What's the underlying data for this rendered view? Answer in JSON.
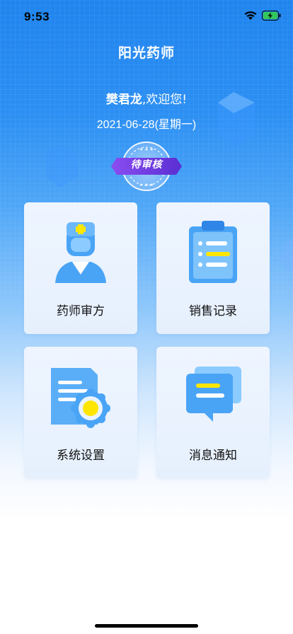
{
  "status_bar": {
    "time": "9:53"
  },
  "header": {
    "title": "阳光药师",
    "user_name": "樊君龙",
    "welcome_suffix": ",欢迎您!",
    "date": "2021-06-28(星期一)"
  },
  "badge": {
    "label": "待审核"
  },
  "menu": {
    "items": [
      {
        "label": "药师审方",
        "icon": "pharmacist-icon"
      },
      {
        "label": "销售记录",
        "icon": "clipboard-icon"
      },
      {
        "label": "系统设置",
        "icon": "settings-document-icon"
      },
      {
        "label": "消息通知",
        "icon": "message-icon"
      }
    ]
  },
  "colors": {
    "primary": "#1f84ee",
    "badge_purple": "#7b3fe4",
    "icon_blue": "#4aa4f6",
    "accent_yellow": "#ffe600"
  }
}
